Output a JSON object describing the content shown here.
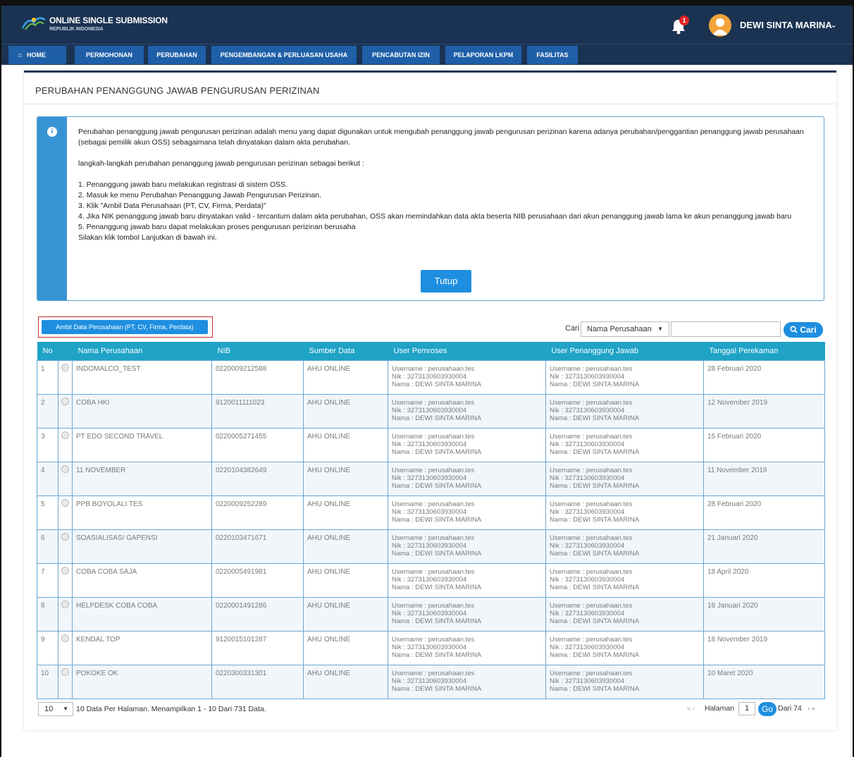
{
  "header": {
    "brand_title": "ONLINE SINGLE SUBMISSION",
    "brand_subtitle": "REPUBLIK INDONESIA",
    "notification_count": "1",
    "user_name": "DEWI SINTA MARINA",
    "user_caret": "⌄"
  },
  "nav": {
    "home": "HOME",
    "items": [
      "PERMOHONAN",
      "PERUBAHAN",
      "PENGEMBANGAN & PERLUASAN USAHA",
      "PENCABUTAN IZIN",
      "PELAPORAN LKPM",
      "FASILITAS"
    ]
  },
  "page": {
    "title": "PERUBAHAN PENANGGUNG JAWAB PENGURUSAN PERIZINAN"
  },
  "info": {
    "icon": "i",
    "intro": "Perubahan penanggung jawab pengurusan perizinan adalah menu yang dapat digunakan untuk mengubah penanggung jawab pengurusan perizinan karena adanya perubahan/penggantian penanggung jawab perusahaan (sebagai pemilik akun OSS) sebagaimana telah dinyatakan dalam akta perubahan.",
    "steps_heading": "langkah-langkah perubahan penanggung jawab pengurusan perizinan sebagai berikut :",
    "steps": [
      "1. Penanggung jawab baru melakukan registrasi di sistem OSS.",
      "2. Masuk ke menu Perubahan Penanggung Jawab Pengurusan Perizinan.",
      "3. Klik \"Ambil Data Perusahaan (PT, CV, Firma, Perdata)\"",
      "4. Jika NIK penanggung jawab baru dinyatakan valid - tercantum dalam akta perubahan, OSS akan memindahkan data akta beserta NIB perusahaan dari akun penanggung jawab lama ke akun penanggung jawab baru",
      "5. Penanggung jawab baru dapat melakukan proses pengurusan perizinan berusaha"
    ],
    "closing": "Silakan klik tombol Lanjutkan di bawah ini.",
    "close_button": "Tutup"
  },
  "actions": {
    "ambil_button": "Ambil Data Perusahaan (PT, CV, Firma, Perdata)",
    "search_label": "Cari",
    "search_field_selected": "Nama Perusahaan",
    "search_input_value": "",
    "search_button": "Cari"
  },
  "table": {
    "headers": [
      "No",
      "Nama Perusahaan",
      "NIB",
      "Sumber Data",
      "User Pemroses",
      "User Penanggung Jawab",
      "Tanggal Perekaman"
    ],
    "user_username": "Username : perusahaan.tes",
    "user_nik": "Nik : 3273130603930004",
    "user_nama": "Nama : DEWI SINTA MARINA",
    "rows": [
      {
        "no": "1",
        "nama": "INDOMALCO_TEST",
        "nib": "0220009212588",
        "sumber": "AHU ONLINE",
        "tanggal": "28 Februari 2020"
      },
      {
        "no": "2",
        "nama": "COBA HKI",
        "nib": "9120011111023",
        "sumber": "AHU ONLINE",
        "tanggal": "12 November 2019"
      },
      {
        "no": "3",
        "nama": "PT EDO SECOND TRAVEL",
        "nib": "0220005271455",
        "sumber": "AHU ONLINE",
        "tanggal": "15 Februari 2020"
      },
      {
        "no": "4",
        "nama": "11 NOVEMBER",
        "nib": "0220104382649",
        "sumber": "AHU ONLINE",
        "tanggal": "11 November 2019"
      },
      {
        "no": "5",
        "nama": "PPB BOYOLALI TES",
        "nib": "0220009252289",
        "sumber": "AHU ONLINE",
        "tanggal": "28 Februari 2020"
      },
      {
        "no": "6",
        "nama": "SOASIALISASI GAPENSI",
        "nib": "0220103471671",
        "sumber": "AHU ONLINE",
        "tanggal": "21 Januari 2020"
      },
      {
        "no": "7",
        "nama": "COBA COBA SAJA",
        "nib": "0220005491981",
        "sumber": "AHU ONLINE",
        "tanggal": "18 April 2020"
      },
      {
        "no": "8",
        "nama": "HELPDESK COBA COBA",
        "nib": "0220001491286",
        "sumber": "AHU ONLINE",
        "tanggal": "18 Januari 2020"
      },
      {
        "no": "9",
        "nama": "KENDAL TOP",
        "nib": "9120015101287",
        "sumber": "AHU ONLINE",
        "tanggal": "18 November 2019"
      },
      {
        "no": "10",
        "nama": "POKOKE OK",
        "nib": "0220300331301",
        "sumber": "AHU ONLINE",
        "tanggal": "10 Maret 2020"
      }
    ]
  },
  "footer": {
    "per_page": "10",
    "summary": "10 Data Per Halaman. Menampilkan 1 - 10 Dari 731 Data.",
    "prev_arrows": "« ‹",
    "page_label": "Halaman",
    "current_page": "1",
    "go_button": "Go",
    "of_pages": "Dari 74",
    "next_arrows": "› »"
  },
  "colors": {
    "header_bg": "#1b3352",
    "nav_button": "#1f5fa8",
    "primary_button": "#1e8fe0",
    "table_header": "#1fa3c6",
    "info_side": "#3794d4",
    "highlight_border": "#c0272d"
  },
  "icons": [
    "oss-logo-icon",
    "bell-icon",
    "user-avatar-icon",
    "chevron-down-icon",
    "home-icon",
    "info-icon",
    "search-icon",
    "radio-icon"
  ]
}
